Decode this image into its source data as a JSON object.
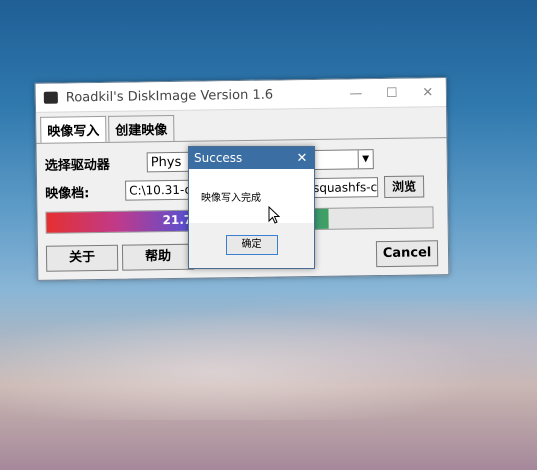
{
  "window": {
    "title": "Roadkil's DiskImage Version 1.6",
    "controls": {
      "minimize": "—",
      "maximize": "☐",
      "close": "✕"
    }
  },
  "tabs": [
    {
      "label": "映像写入",
      "active": true
    },
    {
      "label": "创建映像",
      "active": false
    }
  ],
  "drive": {
    "label": "选择驱动器",
    "value": "Phys"
  },
  "image_file": {
    "label": "映像档:",
    "value_left": "C:\\10.31-o",
    "value_right": "c-squashfs-c",
    "browse_label": "浏览"
  },
  "progress": {
    "text": "21.70",
    "fill_fraction": 0.73
  },
  "buttons": {
    "about": "关于",
    "help": "帮助",
    "cancel": "Cancel"
  },
  "dialog": {
    "title": "Success",
    "close": "✕",
    "message": "映像写入完成",
    "ok_label": "确定"
  },
  "colors": {
    "dialog_title": "#3b6ea3",
    "progress_start": "#e53030",
    "progress_end": "#3fa060"
  }
}
